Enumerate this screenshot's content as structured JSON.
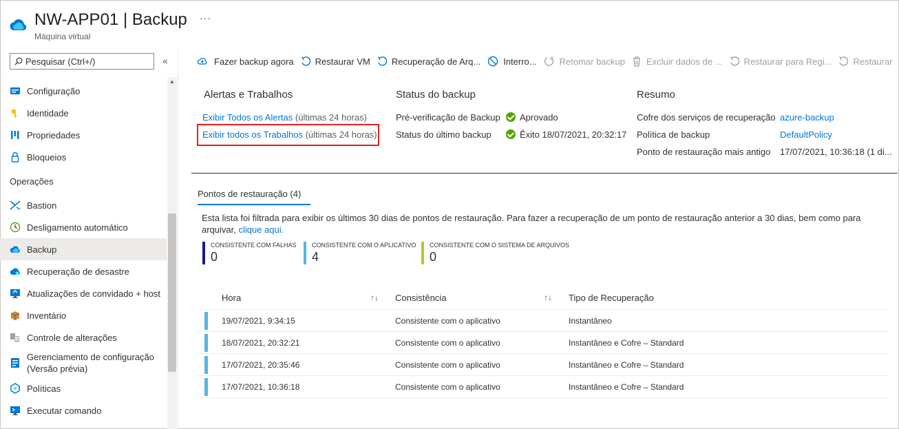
{
  "header": {
    "title_name": "NW-APP01",
    "title_separator": "|",
    "title_page": "Backup",
    "subtitle": "Máquina virtual",
    "more": "···"
  },
  "search": {
    "placeholder": "Pesquisar (Ctrl+/)",
    "collapse": "«"
  },
  "sidebar": {
    "items_top": [
      {
        "label": "Configuração",
        "icon": "config-icon"
      },
      {
        "label": "Identidade",
        "icon": "identity-icon"
      },
      {
        "label": "Propriedades",
        "icon": "properties-icon"
      },
      {
        "label": "Bloqueios",
        "icon": "lock-icon"
      }
    ],
    "section_operations": "Operações",
    "items_ops": [
      {
        "label": "Bastion",
        "icon": "bastion-icon"
      },
      {
        "label": "Desligamento automático",
        "icon": "clock-icon"
      },
      {
        "label": "Backup",
        "icon": "backup-cloud-icon"
      },
      {
        "label": "Recuperação de desastre",
        "icon": "disaster-recovery-icon"
      },
      {
        "label": "Atualizações de convidado + host",
        "icon": "updates-icon"
      },
      {
        "label": "Inventário",
        "icon": "inventory-icon"
      },
      {
        "label": "Controle de alterações",
        "icon": "change-tracking-icon"
      },
      {
        "label": "Gerenciamento de configuração\n(Versão prévia)",
        "icon": "config-management-icon"
      },
      {
        "label": "Políticas",
        "icon": "policies-icon"
      },
      {
        "label": "Executar comando",
        "icon": "run-command-icon"
      }
    ]
  },
  "toolbar": {
    "backup_now": "Fazer backup agora",
    "restore_vm": "Restaurar VM",
    "file_recovery": "Recuperação de Arq...",
    "stop": "Interro...",
    "resume": "Retomar backup",
    "delete": "Excluir dados de ...",
    "restore_secondary": "Restaurar para Regi...",
    "restore": "Restaurar"
  },
  "alerts": {
    "title": "Alertas e Trabalhos",
    "view_alerts": "Exibir Todos os Alertas",
    "view_alerts_suffix": "(últimas 24 horas)",
    "view_jobs": "Exibir todos os Trabalhos",
    "view_jobs_suffix": "(últimas 24 horas)"
  },
  "backup_status": {
    "title": "Status do backup",
    "precheck_label": "Pré-verificação de Backup",
    "precheck_value": "Aprovado",
    "last_label": "Status do último backup",
    "last_value": "Êxito 18/07/2021, 20:32:17"
  },
  "summary": {
    "title": "Resumo",
    "vault_label": "Cofre dos serviços de recuperação",
    "vault_value": "azure-backup",
    "policy_label": "Política de backup",
    "policy_value": "DefaultPolicy",
    "oldest_label": "Ponto de restauração mais antigo",
    "oldest_value": "17/07/2021, 10:36:18 (1 di..."
  },
  "restore_points": {
    "tab": "Pontos de restauração (4)",
    "info": "Esta lista foi filtrada para exibir os últimos 30 dias de pontos de restauração. Para fazer a recuperação de um ponto de restauração anterior a 30 dias, bem como para arquivar,",
    "info_link": "clique aqui.",
    "stats": [
      {
        "label": "CONSISTENTE COM FALHAS",
        "value": "0",
        "color": "#1a1a8c"
      },
      {
        "label": "CONSISTENTE COM O APLICATIVO",
        "value": "4",
        "color": "#5ab4de"
      },
      {
        "label": "CONSISTENTE COM O SISTEMA DE ARQUIVOS",
        "value": "0",
        "color": "#b4c830"
      }
    ],
    "columns": {
      "time": "Hora",
      "consistency": "Consistência",
      "type": "Tipo de Recuperação",
      "sort": "↑↓"
    },
    "rows": [
      {
        "time": "19/07/2021, 9:34:15",
        "consistency": "Consistente com o aplicativo",
        "type": "Instantâneo"
      },
      {
        "time": "18/07/2021, 20:32:21",
        "consistency": "Consistente com o aplicativo",
        "type": "Instantâneo e Cofre – Standard"
      },
      {
        "time": "17/07/2021, 20:35:46",
        "consistency": "Consistente com o aplicativo",
        "type": "Instantâneo e Cofre – Standard"
      },
      {
        "time": "17/07/2021, 10:36:18",
        "consistency": "Consistente com o aplicativo",
        "type": "Instantâneo e Cofre – Standard"
      }
    ]
  }
}
